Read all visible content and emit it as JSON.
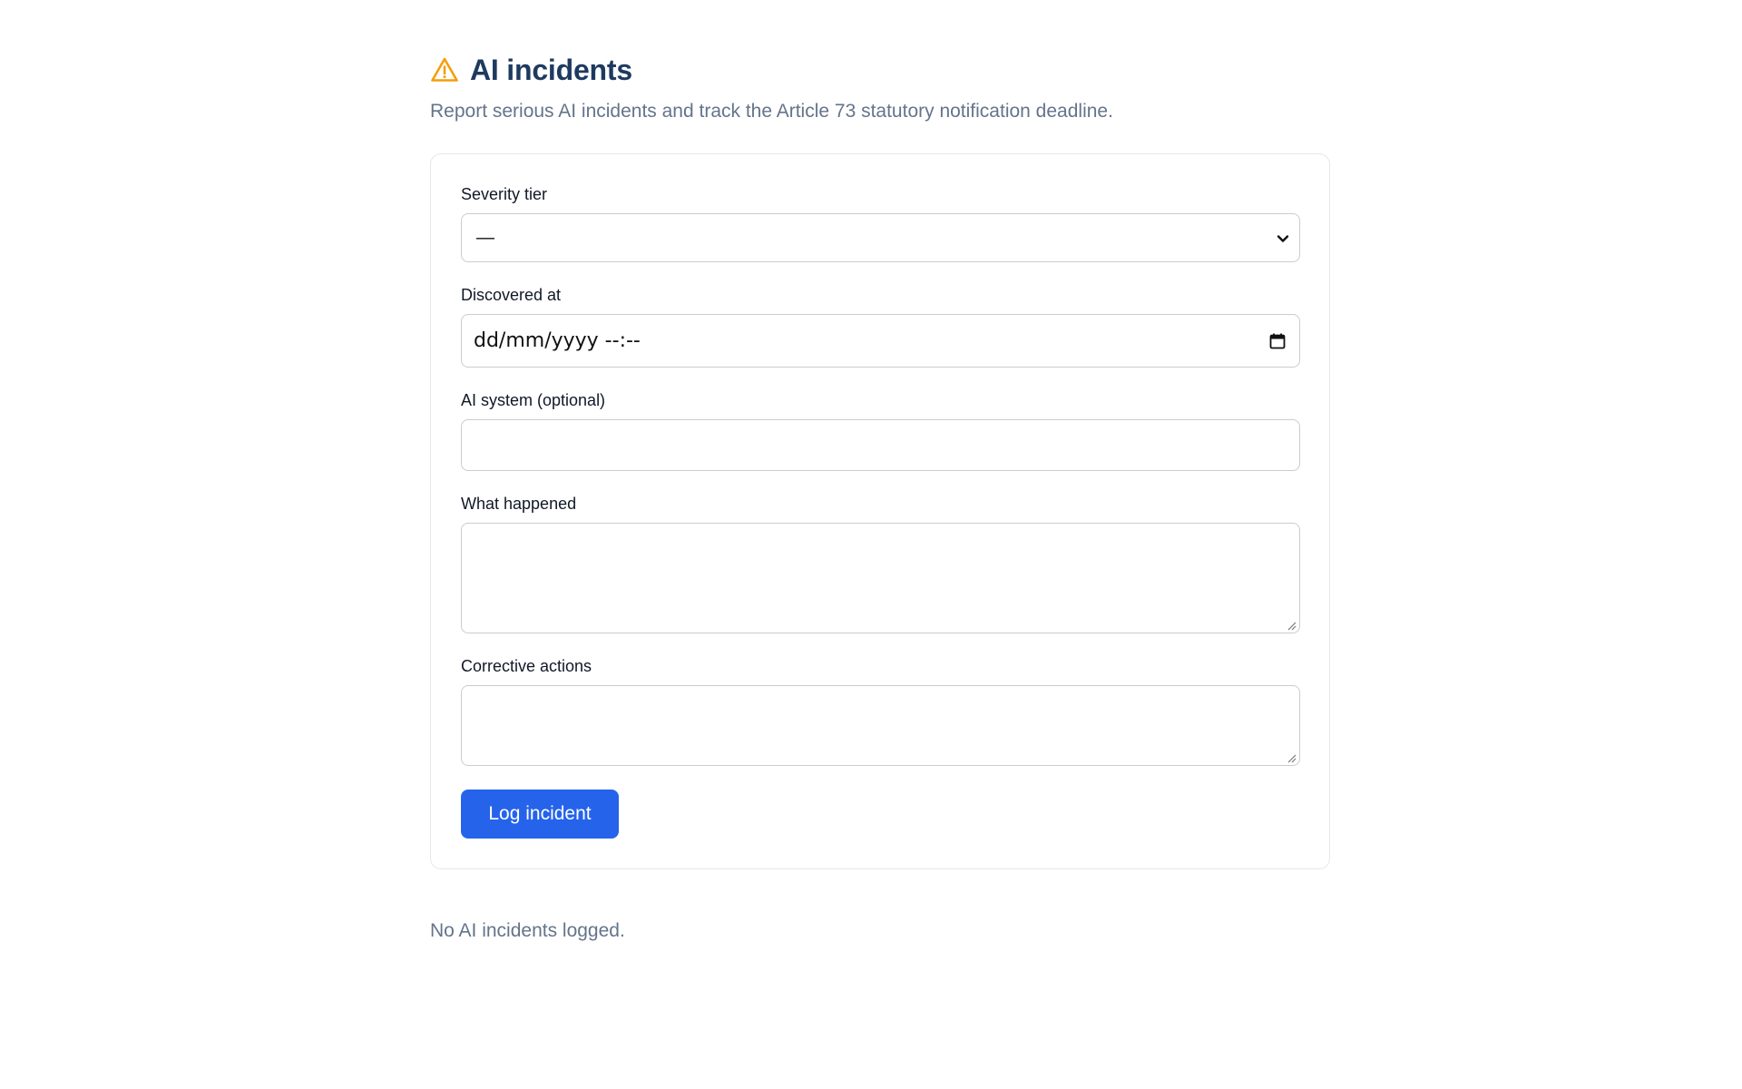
{
  "header": {
    "title": "AI incidents",
    "subtitle": "Report serious AI incidents and track the Article 73 statutory notification deadline.",
    "icon": "warning-triangle-icon",
    "icon_color": "#f59e0b"
  },
  "form": {
    "severity": {
      "label": "Severity tier",
      "value": "—"
    },
    "discovered": {
      "label": "Discovered at",
      "placeholder": "dd/mm/yyyy --:--"
    },
    "system": {
      "label": "AI system (optional)",
      "value": ""
    },
    "what": {
      "label": "What happened",
      "value": ""
    },
    "corrective": {
      "label": "Corrective actions",
      "value": ""
    },
    "submit_label": "Log incident"
  },
  "list": {
    "empty_text": "No AI incidents logged."
  },
  "colors": {
    "accent": "#2563eb",
    "title": "#1e3a5f",
    "muted": "#64748b"
  }
}
